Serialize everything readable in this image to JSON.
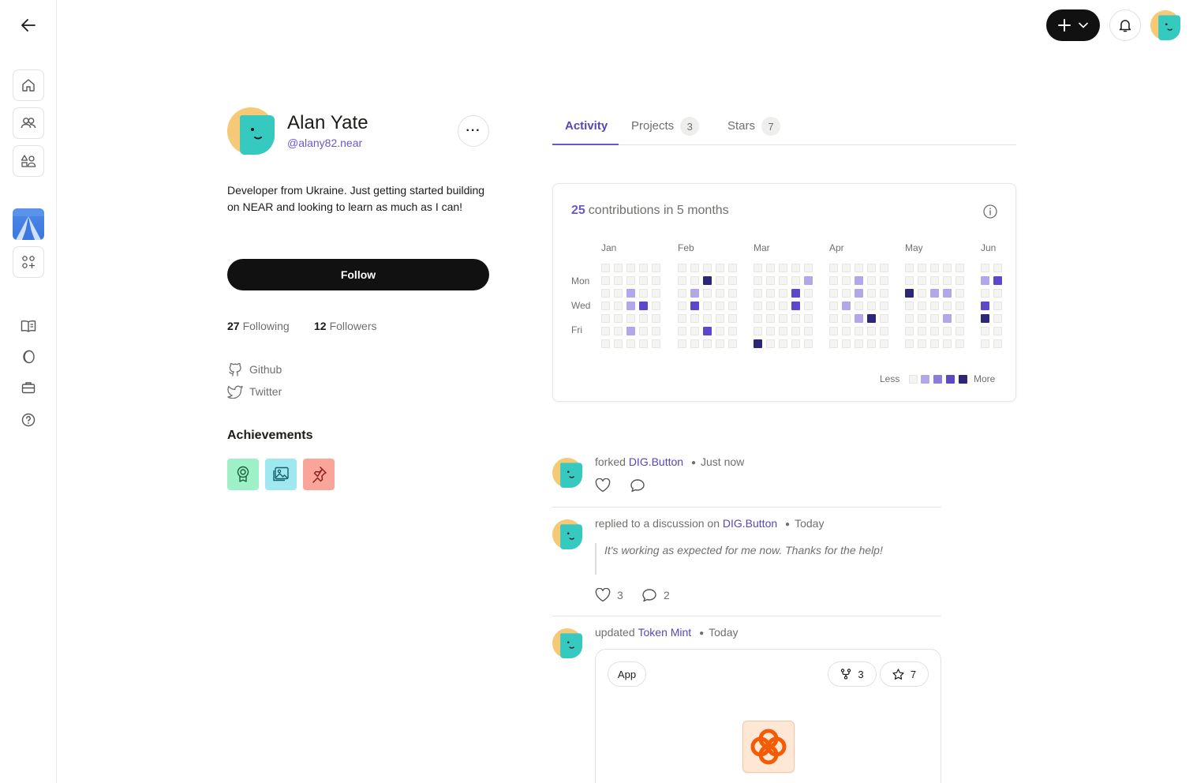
{
  "profile": {
    "name": "Alan Yate",
    "handle": "@alany82.near",
    "bio": "Developer from Ukraine. Just getting started building on NEAR and looking to learn as much as I can!",
    "follow_label": "Follow",
    "more_label": "···",
    "following_count": "27",
    "following_label": "Following",
    "followers_count": "12",
    "followers_label": "Followers",
    "links": [
      {
        "label": "Github",
        "icon": "github-icon"
      },
      {
        "label": "Twitter",
        "icon": "twitter-icon"
      }
    ],
    "achievements_title": "Achievements"
  },
  "tabs": [
    {
      "label": "Activity",
      "count": ""
    },
    {
      "label": "Projects",
      "count": "3"
    },
    {
      "label": "Stars",
      "count": "7"
    }
  ],
  "contributions": {
    "count": "25",
    "text": "contributions in 5 months",
    "months": [
      "Jan",
      "Feb",
      "Mar",
      "Apr",
      "May",
      "Jun"
    ],
    "day_labels": [
      "Mon",
      "Wed",
      "Fri"
    ],
    "legend_less": "Less",
    "legend_more": "More",
    "grid": [
      [
        [
          0,
          0,
          0,
          0,
          0,
          0,
          0
        ],
        [
          0,
          0,
          0,
          0,
          0,
          0,
          0
        ],
        [
          0,
          0,
          1,
          1,
          0,
          1,
          0
        ],
        [
          0,
          0,
          0,
          3,
          0,
          0,
          0
        ],
        [
          0,
          0,
          0,
          0,
          0,
          0,
          0
        ]
      ],
      [
        [
          0,
          0,
          0,
          0,
          0,
          0,
          0
        ],
        [
          0,
          0,
          1,
          3,
          0,
          0,
          0
        ],
        [
          0,
          4,
          0,
          0,
          0,
          3,
          0
        ],
        [
          0,
          0,
          0,
          0,
          0,
          0,
          0
        ],
        [
          0,
          0,
          0,
          0,
          0,
          0,
          0
        ]
      ],
      [
        [
          0,
          0,
          0,
          0,
          0,
          0,
          4
        ],
        [
          0,
          0,
          0,
          0,
          0,
          0,
          0
        ],
        [
          0,
          0,
          0,
          0,
          0,
          0,
          0
        ],
        [
          0,
          0,
          3,
          3,
          0,
          0,
          0
        ],
        [
          0,
          1,
          0,
          0,
          0,
          0,
          0
        ]
      ],
      [
        [
          0,
          0,
          0,
          0,
          0,
          0,
          0
        ],
        [
          0,
          0,
          0,
          1,
          0,
          0,
          0
        ],
        [
          0,
          1,
          1,
          0,
          1,
          0,
          0
        ],
        [
          0,
          0,
          0,
          0,
          4,
          0,
          0
        ],
        [
          0,
          0,
          0,
          0,
          0,
          0,
          0
        ]
      ],
      [
        [
          0,
          0,
          4,
          0,
          0,
          0,
          0
        ],
        [
          0,
          0,
          0,
          0,
          0,
          0,
          0
        ],
        [
          0,
          0,
          1,
          0,
          0,
          0,
          0
        ],
        [
          0,
          0,
          1,
          0,
          1,
          0,
          0
        ],
        [
          0,
          0,
          0,
          0,
          0,
          0,
          0
        ]
      ],
      [
        [
          0,
          1,
          0,
          3,
          4,
          0,
          0
        ],
        [
          0,
          3,
          0,
          0,
          0,
          0,
          0
        ]
      ]
    ]
  },
  "feed": [
    {
      "action": "forked",
      "target": "DIG.Button",
      "time": "Just now"
    },
    {
      "action": "replied to a discussion on",
      "target": "DIG.Button",
      "time": "Today",
      "quote": "It's working as expected for me now. Thanks for the help!",
      "likes": "3",
      "comments": "2"
    },
    {
      "action": "updated",
      "target": "Token Mint",
      "time": "Today",
      "card": {
        "type_label": "App",
        "forks": "3",
        "stars": "7"
      }
    }
  ],
  "colors": {
    "accent": "#6e56cf",
    "dark": "#111111"
  }
}
